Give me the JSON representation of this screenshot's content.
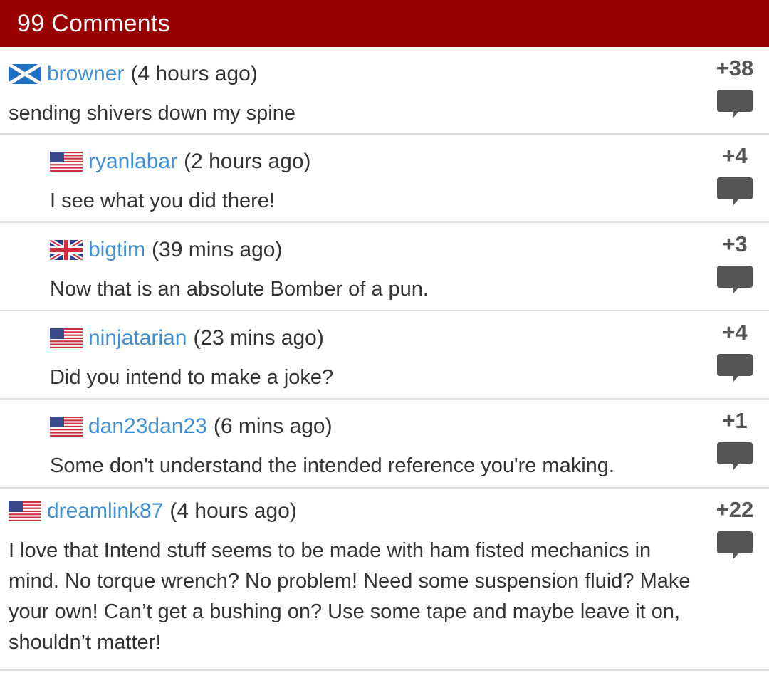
{
  "header": {
    "title": "99 Comments"
  },
  "colors": {
    "header_bg": "#990000",
    "username": "#3f8fd2",
    "divider": "#dcdcdc"
  },
  "comments": [
    {
      "user": "browner",
      "time": "(4 hours ago)",
      "text": "sending shivers down my spine",
      "score": "+38",
      "flag": "scotland-flag-icon",
      "level": 0
    },
    {
      "user": "ryanlabar",
      "time": "(2 hours ago)",
      "text": "I see what you did there!",
      "score": "+4",
      "flag": "usa-flag-icon",
      "level": 1
    },
    {
      "user": "bigtim",
      "time": "(39 mins ago)",
      "text": "Now that is an absolute Bomber of a pun.",
      "score": "+3",
      "flag": "uk-flag-icon",
      "level": 1
    },
    {
      "user": "ninjatarian",
      "time": "(23 mins ago)",
      "text": "Did you intend to make a joke?",
      "score": "+4",
      "flag": "usa-flag-icon",
      "level": 1
    },
    {
      "user": "dan23dan23",
      "time": "(6 mins ago)",
      "text": "Some don't understand the intended reference you're making.",
      "score": "+1",
      "flag": "usa-flag-icon",
      "level": 1
    },
    {
      "user": "dreamlink87",
      "time": "(4 hours ago)",
      "text": "I love that Intend stuff seems to be made with ham fisted mechanics in mind. No torque wrench? No problem! Need some suspension fluid? Make your own! Can’t get a bushing on? Use some tape and maybe leave it on, shouldn’t matter!",
      "score": "+22",
      "flag": "usa-flag-icon",
      "level": 0
    }
  ]
}
